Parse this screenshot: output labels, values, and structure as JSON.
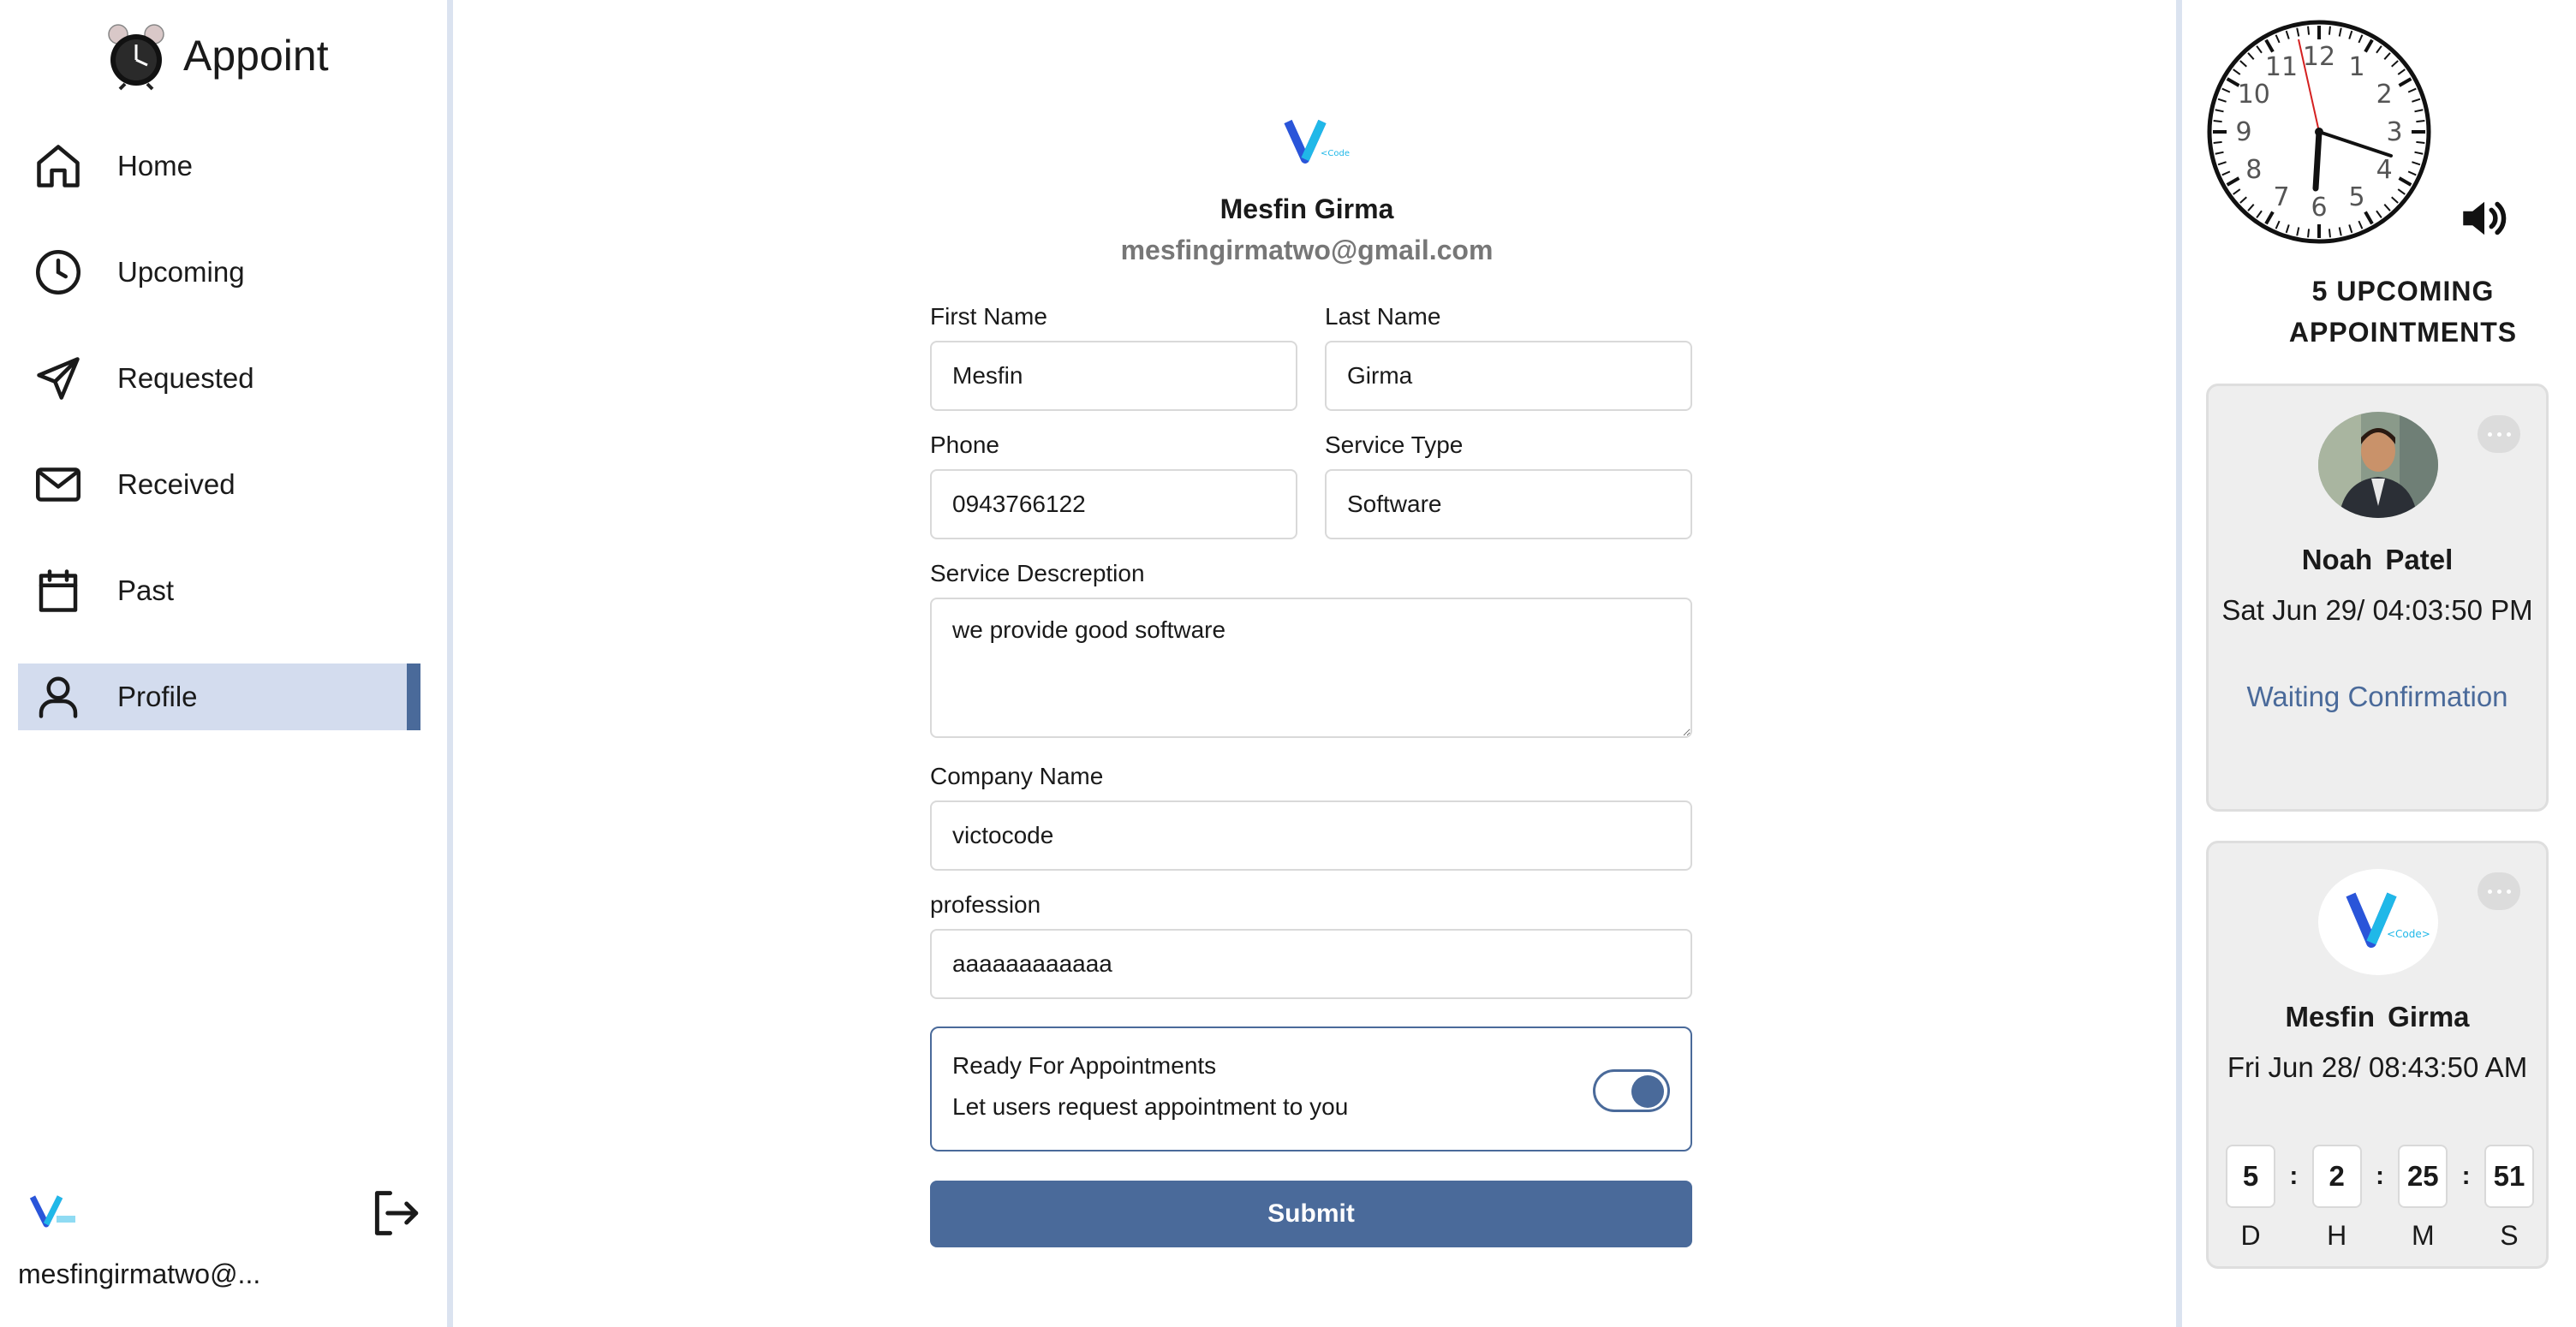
{
  "app": {
    "name": "Appoint",
    "accent": "#4a6a9a",
    "active_bg": "#d3dcee"
  },
  "sidebar": {
    "items": [
      {
        "label": "Home",
        "icon": "home-icon"
      },
      {
        "label": "Upcoming",
        "icon": "clock-icon"
      },
      {
        "label": "Requested",
        "icon": "send-icon"
      },
      {
        "label": "Received",
        "icon": "mail-icon"
      },
      {
        "label": "Past",
        "icon": "calendar-icon"
      },
      {
        "label": "Profile",
        "icon": "user-icon",
        "active": true
      }
    ],
    "footer_email": "mesfingirmatwo@...",
    "logout_icon": "logout-icon"
  },
  "profile": {
    "name": "Mesfin Girma",
    "email": "mesfingirmatwo@gmail.com"
  },
  "form": {
    "first_name": {
      "label": "First Name",
      "value": "Mesfin"
    },
    "last_name": {
      "label": "Last Name",
      "value": "Girma"
    },
    "phone": {
      "label": "Phone",
      "value": "0943766122"
    },
    "service_type": {
      "label": "Service Type",
      "value": "Software"
    },
    "service_description": {
      "label": "Service Descreption",
      "value": "we provide good software"
    },
    "company_name": {
      "label": "Company Name",
      "value": "victocode"
    },
    "profession": {
      "label": "profession",
      "value": "aaaaaaaaaaaa"
    },
    "ready": {
      "title": "Ready For Appointments",
      "subtitle": "Let users request appointment to you",
      "enabled": true
    },
    "submit_label": "Submit"
  },
  "right_panel": {
    "clock": {
      "numerals": [
        "12",
        "1",
        "2",
        "3",
        "4",
        "5",
        "6",
        "7",
        "8",
        "9",
        "10",
        "11"
      ]
    },
    "speaker_icon": "speaker-icon",
    "upcoming_title": "5 UPCOMING APPOINTMENTS",
    "appointments": [
      {
        "name": "Noah  Patel",
        "time": "Sat Jun 29/ 04:03:50 PM",
        "status": "Waiting Confirmation"
      },
      {
        "name": "Mesfin  Girma",
        "time": "Fri Jun 28/ 08:43:50 AM",
        "countdown": {
          "d": "5",
          "h": "2",
          "m": "25",
          "s": "51"
        },
        "countdown_labels": {
          "d": "D",
          "h": "H",
          "m": "M",
          "s": "S"
        }
      }
    ]
  }
}
